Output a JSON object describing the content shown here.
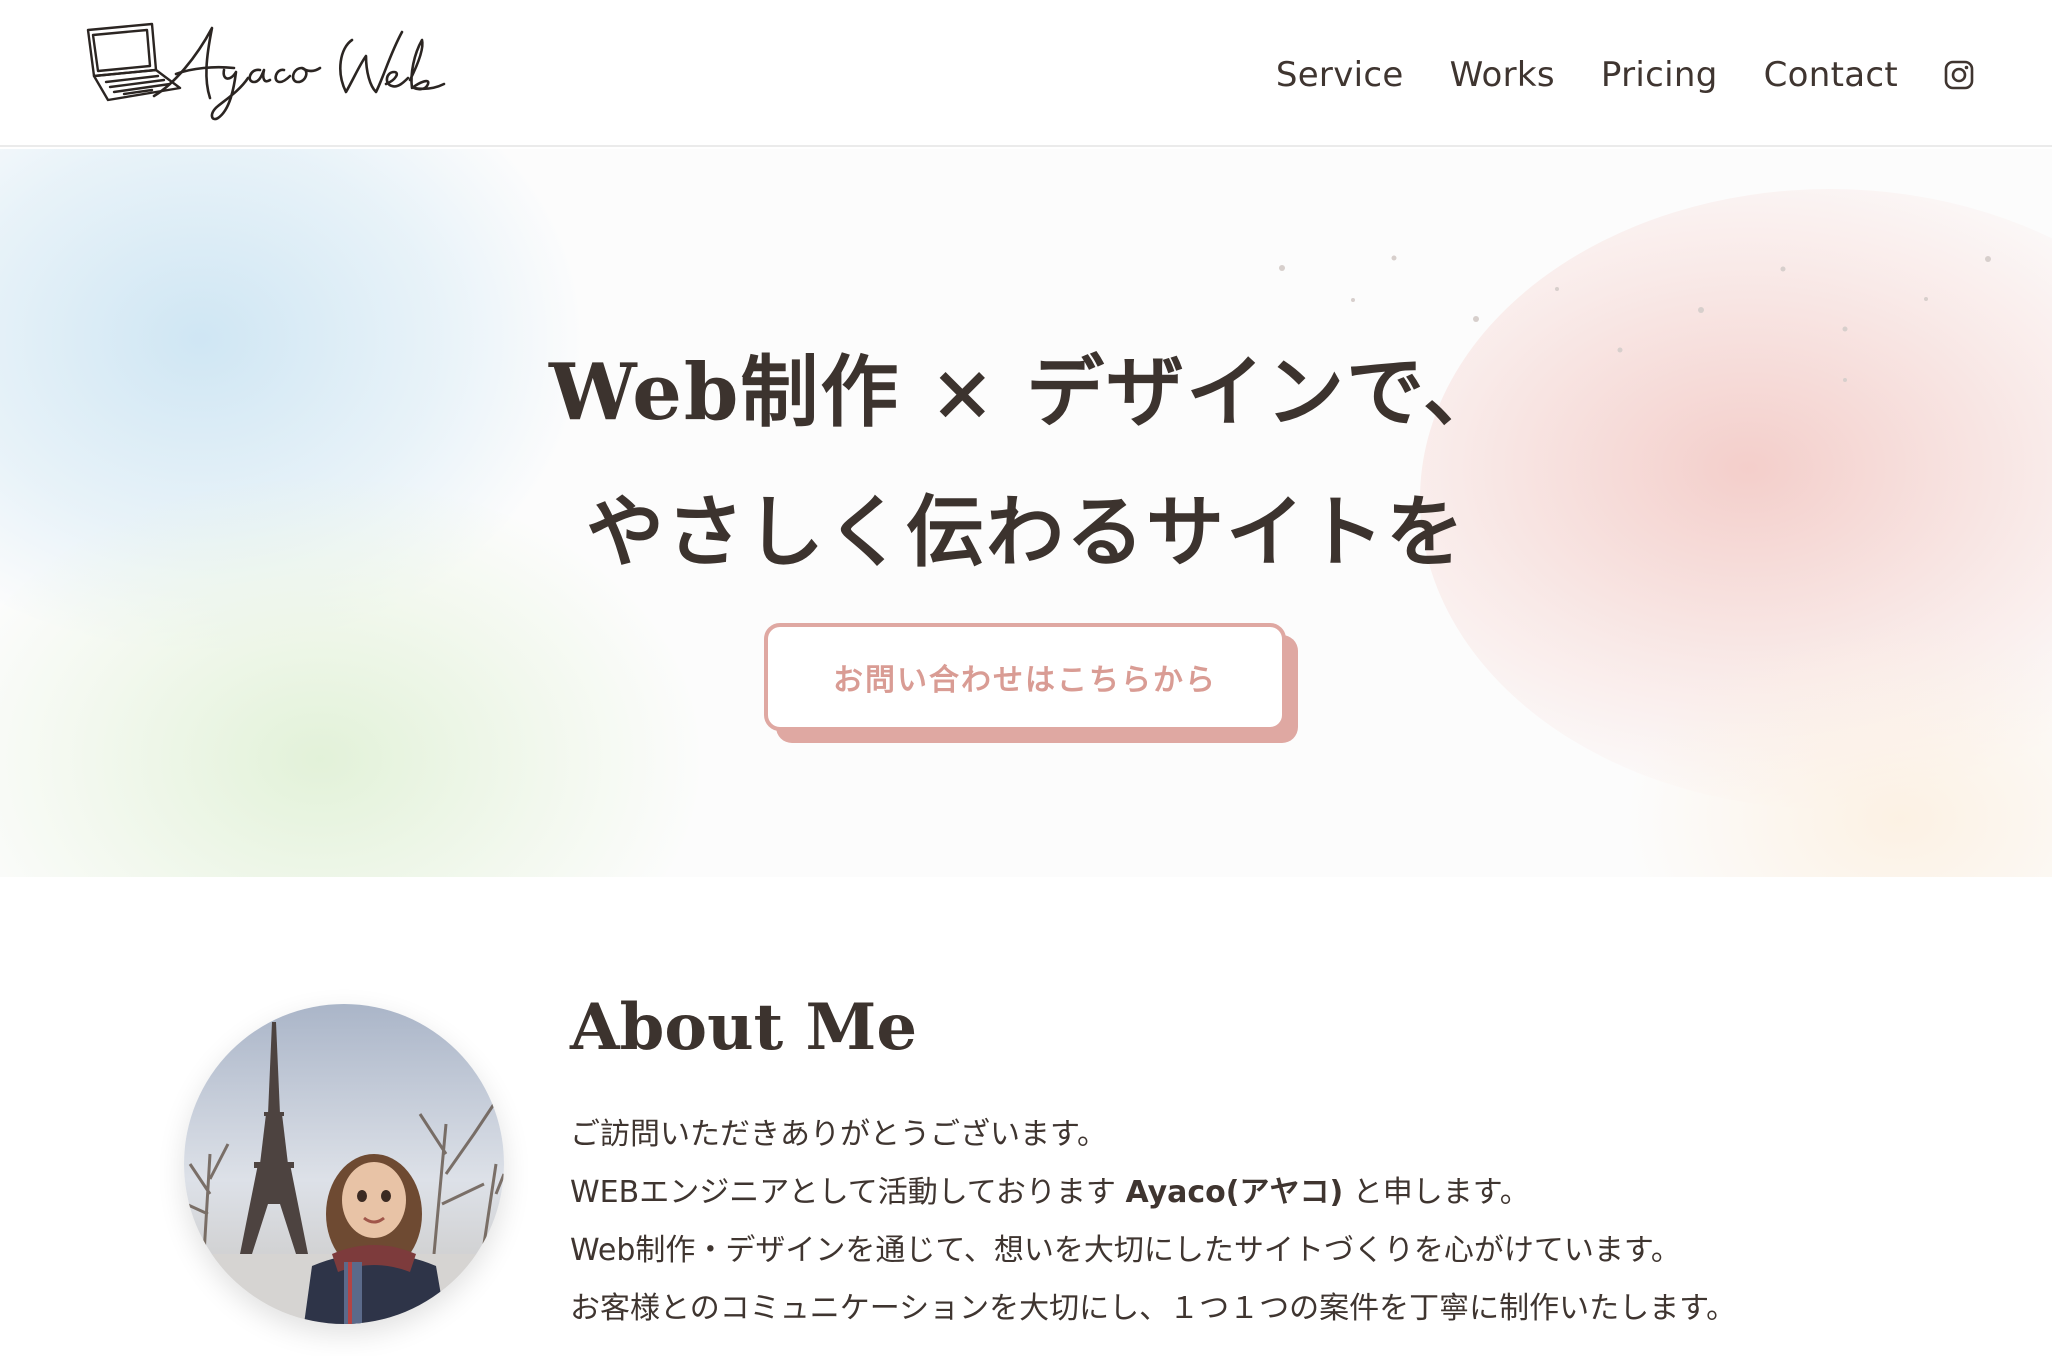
{
  "header": {
    "logo_text": "Ayaco Web",
    "nav": [
      {
        "label": "Service"
      },
      {
        "label": "Works"
      },
      {
        "label": "Pricing"
      },
      {
        "label": "Contact"
      }
    ],
    "social_icon": "instagram-icon"
  },
  "hero": {
    "title_line1": "Web制作 × デザインで、",
    "title_line2": "やさしく伝わるサイトを",
    "cta_label": "お問い合わせはこちらから"
  },
  "about": {
    "title": "About Me",
    "line1": "ご訪問いただきありがとうございます。",
    "line2_prefix": "WEBエンジニアとして活動しております",
    "line2_name": "Ayaco(アヤコ)",
    "line2_suffix": "と申します。",
    "line3": "Web制作・デザインを通じて、想いを大切にしたサイトづくりを心がけています。",
    "line4": "お客様とのコミュニケーションを大切にし、１つ１つの案件を丁寧に制作いたします。"
  },
  "colors": {
    "text": "#3f3530",
    "accent": "#dfa8a2",
    "accent_text": "#d99c94",
    "blob_blue": "#d6eaf5",
    "blob_green": "#e6f3dc",
    "blob_pink": "#f5d6d2"
  }
}
